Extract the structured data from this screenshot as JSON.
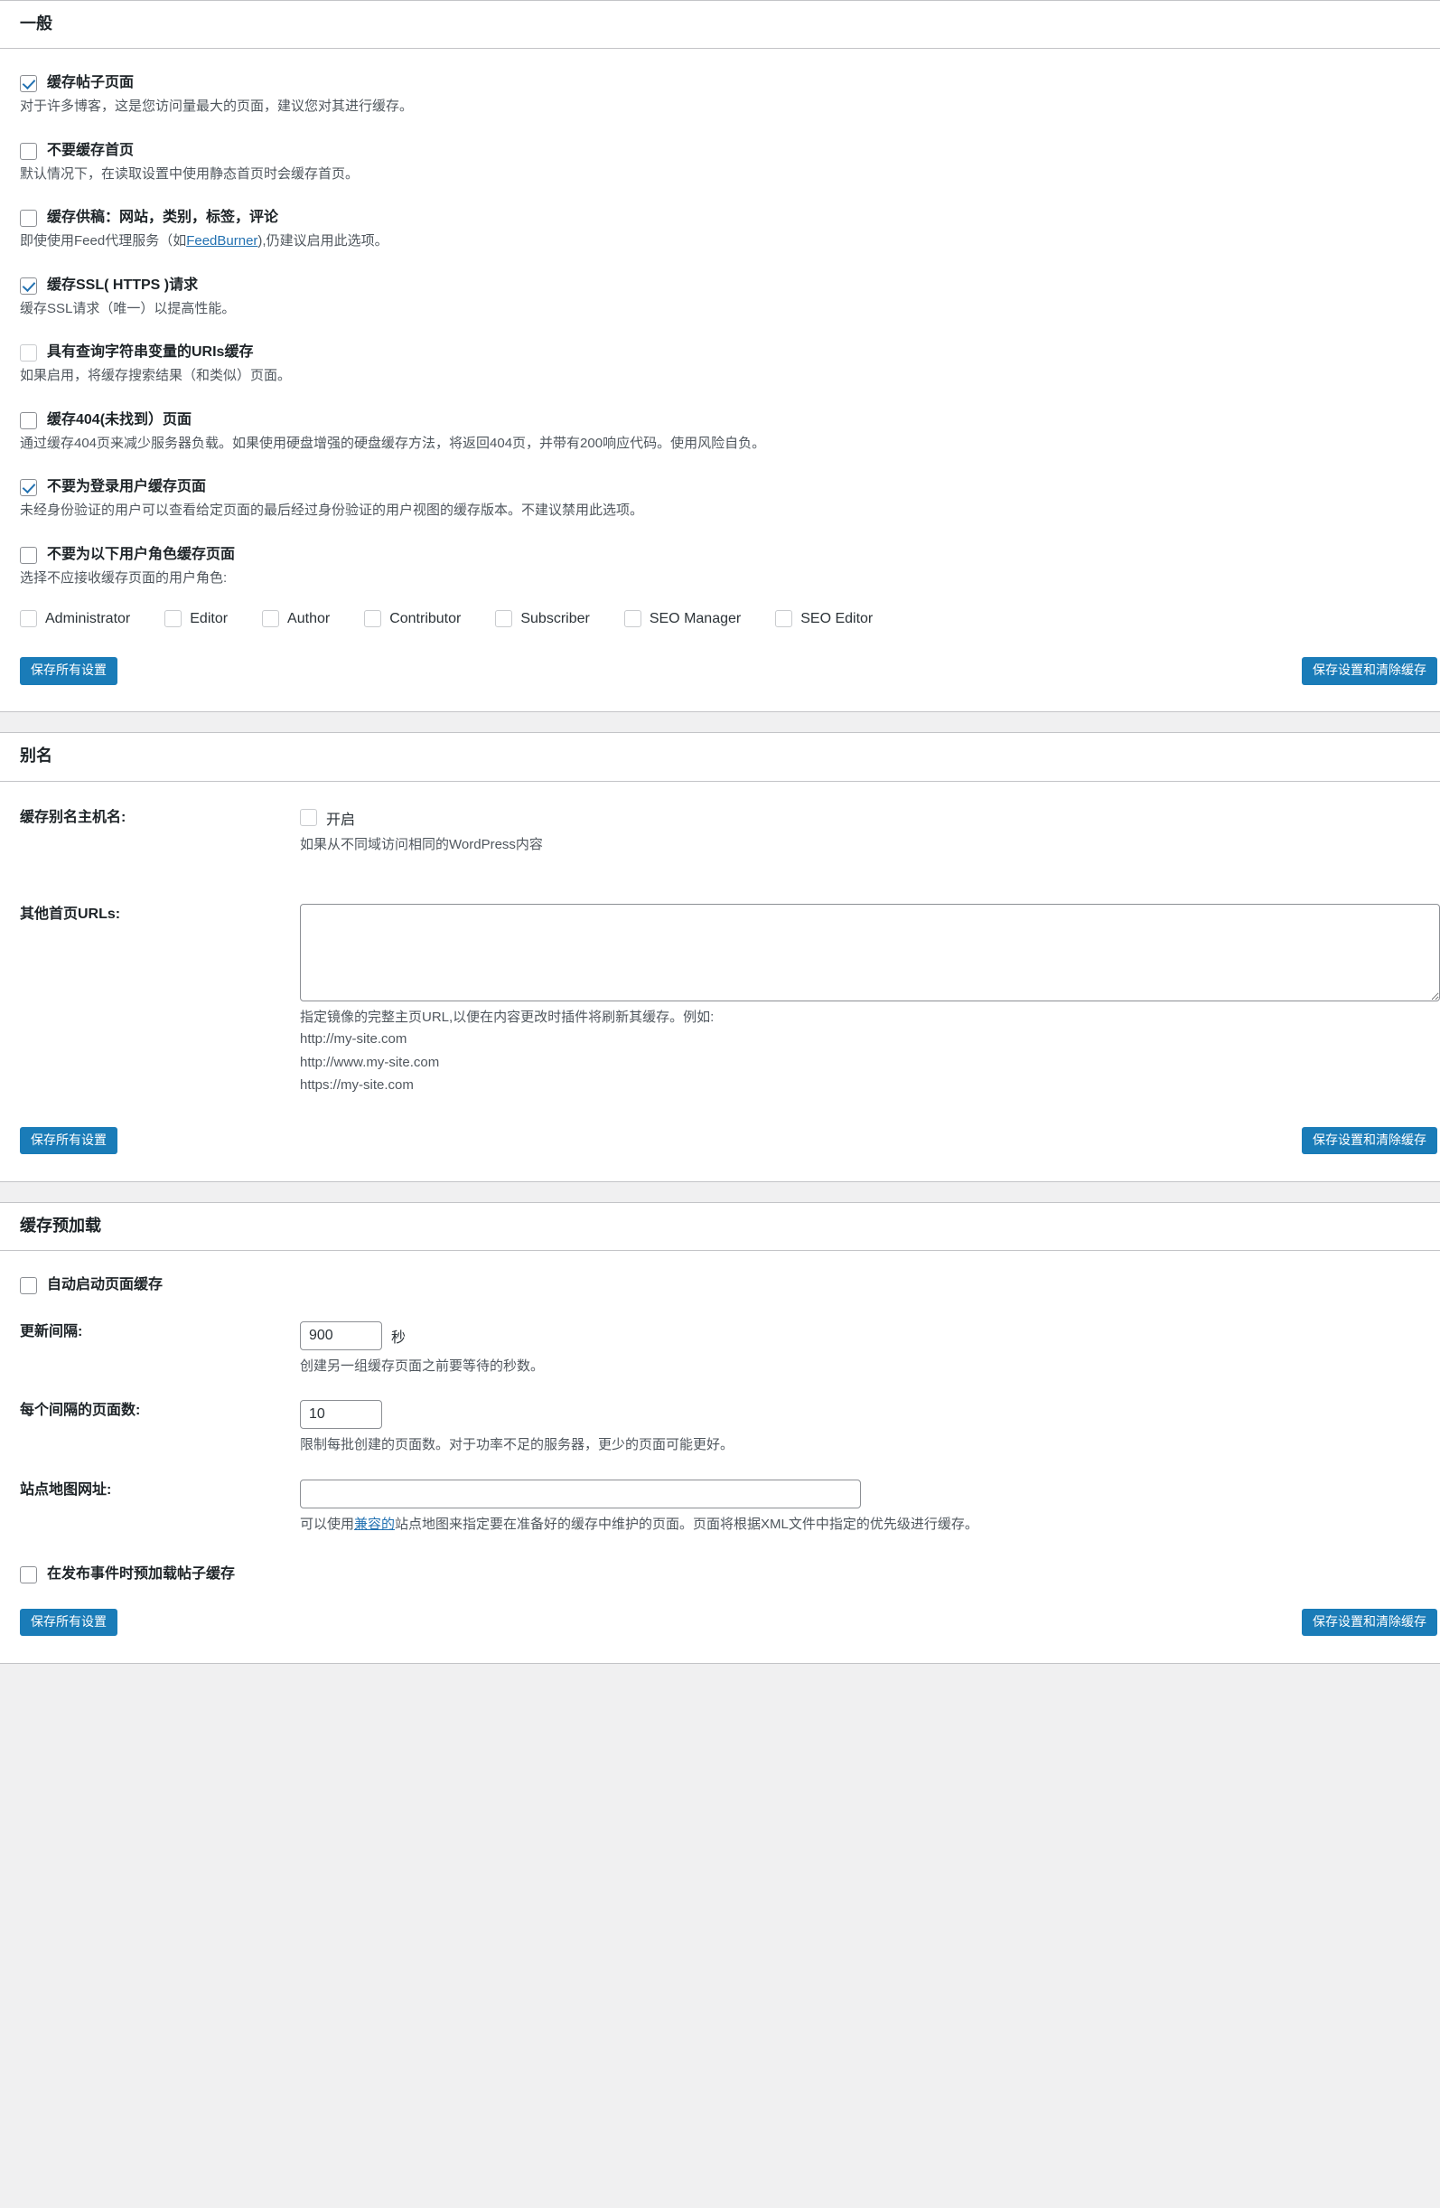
{
  "theme": {
    "accent": "#2271b1",
    "button_bg": "#1a7cb8",
    "panel_bg": "#ffffff",
    "page_bg": "#f0f0f1",
    "border": "#c3c4c7"
  },
  "sections": {
    "general": {
      "title": "一般",
      "options": [
        {
          "label": "缓存帖子页面",
          "desc": "对于许多博客，这是您访问量最大的页面，建议您对其进行缓存。",
          "checked": true
        },
        {
          "label": "不要缓存首页",
          "desc": "默认情况下，在读取设置中使用静态首页时会缓存首页。",
          "checked": false
        },
        {
          "label": "缓存供稿：网站，类别，标签，评论",
          "desc_pre": "即使使用Feed代理服务（如",
          "desc_link": "FeedBurner",
          "desc_post": "),仍建议启用此选项。",
          "checked": false
        },
        {
          "label": "缓存SSL( HTTPS )请求",
          "desc": "缓存SSL请求（唯一）以提高性能。",
          "checked": true
        },
        {
          "label": "具有查询字符串变量的URIs缓存",
          "desc": "如果启用，将缓存搜索结果（和类似）页面。",
          "checked": false,
          "dim": true
        },
        {
          "label": "缓存404(未找到）页面",
          "desc": "通过缓存404页来减少服务器负载。如果使用硬盘增强的硬盘缓存方法，将返回404页，并带有200响应代码。使用风险自负。",
          "checked": false
        },
        {
          "label": "不要为登录用户缓存页面",
          "desc": "未经身份验证的用户可以查看给定页面的最后经过身份验证的用户视图的缓存版本。不建议禁用此选项。",
          "checked": true
        },
        {
          "label": "不要为以下用户角色缓存页面",
          "desc": "选择不应接收缓存页面的用户角色:",
          "checked": false
        }
      ],
      "roles": [
        {
          "label": "Administrator",
          "checked": false
        },
        {
          "label": "Editor",
          "checked": false
        },
        {
          "label": "Author",
          "checked": false
        },
        {
          "label": "Contributor",
          "checked": false
        },
        {
          "label": "Subscriber",
          "checked": false
        },
        {
          "label": "SEO Manager",
          "checked": false
        },
        {
          "label": "SEO Editor",
          "checked": false
        }
      ],
      "save_all_label": "保存所有设置",
      "save_clear_label": "保存设置和清除缓存"
    },
    "alias": {
      "title": "别名",
      "host_label": "缓存别名主机名:",
      "host_toggle_label": "开启",
      "host_toggle_checked": false,
      "host_desc": "如果从不同域访问相同的WordPress内容",
      "urls_label": "其他首页URLs:",
      "urls_value": "",
      "urls_desc": "指定镜像的完整主页URL,以便在内容更改时插件将刷新其缓存。例如:",
      "urls_examples": [
        "http://my-site.com",
        "http://www.my-site.com",
        "https://my-site.com"
      ],
      "save_all_label": "保存所有设置",
      "save_clear_label": "保存设置和清除缓存"
    },
    "preload": {
      "title": "缓存预加载",
      "auto_label": "自动启动页面缓存",
      "auto_checked": false,
      "interval_label": "更新间隔:",
      "interval_value": "900",
      "interval_unit": "秒",
      "interval_desc": "创建另一组缓存页面之前要等待的秒数。",
      "pages_label": "每个间隔的页面数:",
      "pages_value": "10",
      "pages_desc": "限制每批创建的页面数。对于功率不足的服务器，更少的页面可能更好。",
      "sitemap_label": "站点地图网址:",
      "sitemap_value": "",
      "sitemap_desc_pre": "可以使用",
      "sitemap_desc_link": "兼容的",
      "sitemap_desc_post": "站点地图来指定要在准备好的缓存中维护的页面。页面将根据XML文件中指定的优先级进行缓存。",
      "preload_posts_label": "在发布事件时预加载帖子缓存",
      "preload_posts_checked": false,
      "save_all_label": "保存所有设置",
      "save_clear_label": "保存设置和清除缓存"
    }
  }
}
